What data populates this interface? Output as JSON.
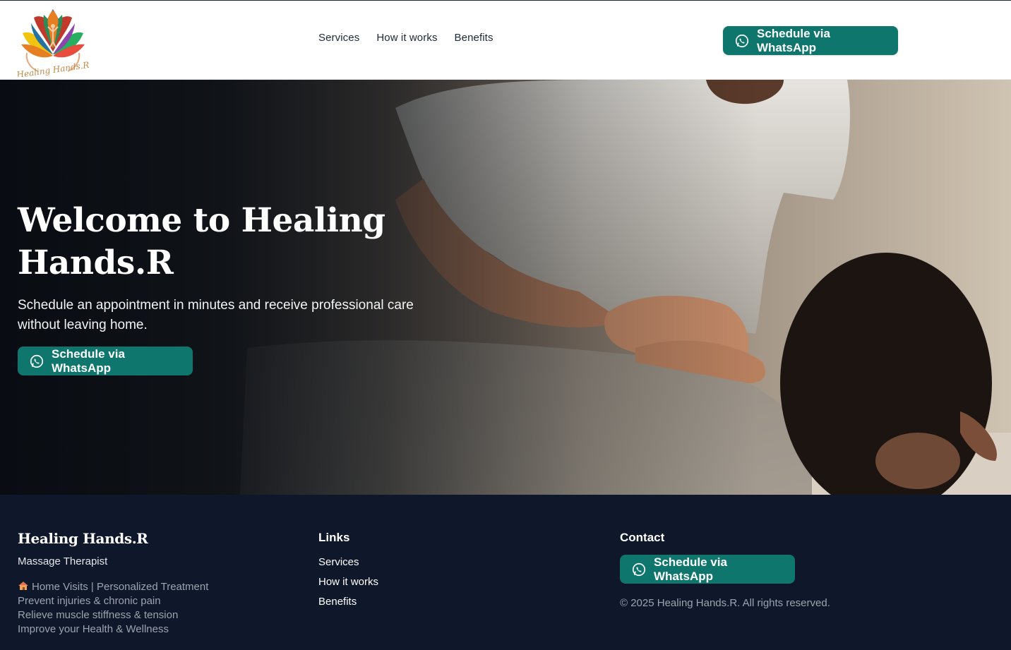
{
  "brand": {
    "logo_text": "Healing Hands.R",
    "name": "Healing Hands.R",
    "role": "Massage Therapist"
  },
  "nav": {
    "items": [
      "Services",
      "How it works",
      "Benefits"
    ]
  },
  "cta": {
    "label": "Schedule via WhatsApp",
    "icon": "whatsapp-icon",
    "color": "#0f766e"
  },
  "hero": {
    "title": "Welcome to Healing Hands.R",
    "subtitle": "Schedule an appointment in minutes and receive professional care without leaving home."
  },
  "footer": {
    "features": [
      {
        "icon": "house-icon",
        "text": "Home Visits | Personalized Treatment"
      },
      {
        "text": "Prevent injuries & chronic pain"
      },
      {
        "text": "Relieve muscle stiffness & tension"
      },
      {
        "text": "Improve your Health & Wellness"
      }
    ],
    "links_heading": "Links",
    "links": [
      "Services",
      "How it works",
      "Benefits"
    ],
    "contact_heading": "Contact",
    "copyright": "© 2025 Healing Hands.R. All rights reserved."
  },
  "colors": {
    "accent": "#0f766e",
    "footer_bg": "#0f172a",
    "header_bg": "#ffffff"
  }
}
